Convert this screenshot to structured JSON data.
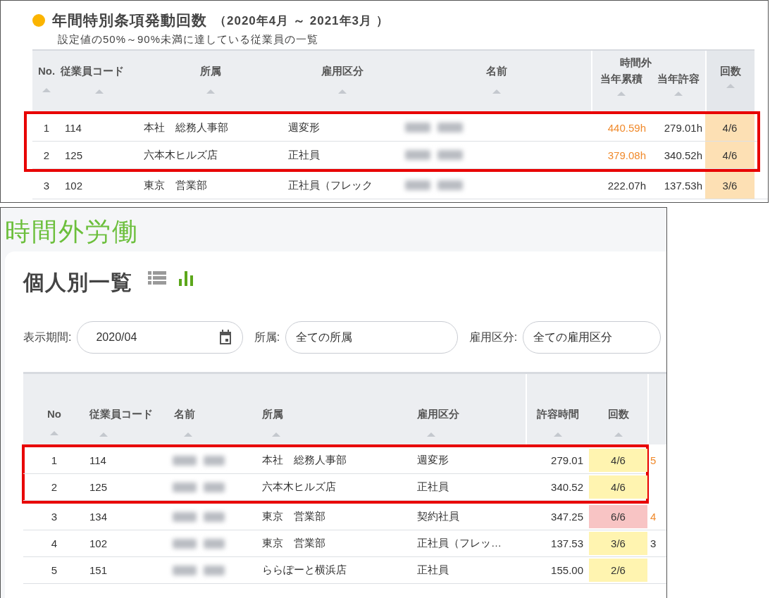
{
  "top_panel": {
    "title": "年間特別条項発動回数",
    "period": "（2020年4月 ～ 2021年3月 ）",
    "subtitle": "設定値の50%～90%未満に達している従業員の一覧",
    "columns": [
      "No.",
      "従業員コード",
      "所属",
      "雇用区分",
      "名前"
    ],
    "group_header": "時間外",
    "group_columns": [
      "当年累積",
      "当年許容"
    ],
    "count_column": "回数",
    "rows": [
      {
        "no": "1",
        "code": "114",
        "dept": "本社　総務人事部",
        "type": "週変形",
        "over": true,
        "total": "440.59h",
        "allowed": "279.01h",
        "count": "4/6",
        "highlighted": true
      },
      {
        "no": "2",
        "code": "125",
        "dept": "六本木ヒルズ店",
        "type": "正社員",
        "over": true,
        "total": "379.08h",
        "allowed": "340.52h",
        "count": "4/6",
        "highlighted": true
      },
      {
        "no": "3",
        "code": "102",
        "dept": "東京　営業部",
        "type": "正社員（フレック",
        "over": false,
        "total": "222.07h",
        "allowed": "137.53h",
        "count": "3/6",
        "highlighted": false
      }
    ]
  },
  "bottom_panel": {
    "page_title": "時間外労働",
    "card_title": "個人別一覧",
    "view_buttons": [
      {
        "kind": "list",
        "selected": false
      },
      {
        "kind": "chart",
        "selected": true
      }
    ],
    "filters": [
      {
        "label": "表示期間:",
        "value": "2020/04",
        "kind": "date"
      },
      {
        "label": "所属:",
        "value": "全ての所属",
        "kind": "select"
      },
      {
        "label": "雇用区分:",
        "value": "全ての雇用区分",
        "kind": "select"
      }
    ],
    "columns": [
      "No",
      "従業員コード",
      "名前",
      "所属",
      "雇用区分",
      "許容時間",
      "回数"
    ],
    "rows": [
      {
        "no": "1",
        "code": "114",
        "dept": "本社　総務人事部",
        "type": "週変形",
        "allowed": "279.01",
        "count": {
          "text": "4/6",
          "color": "#fff4b0"
        },
        "column_8": "5",
        "column_8_over": true,
        "highlighted": true
      },
      {
        "no": "2",
        "code": "125",
        "dept": "六本木ヒルズ店",
        "type": "正社員",
        "allowed": "340.52",
        "count": {
          "text": "4/6",
          "color": "#fff4b0"
        },
        "highlighted": true
      },
      {
        "no": "3",
        "code": "134",
        "dept": "東京　営業部",
        "type": "契約社員",
        "allowed": "347.25",
        "count": {
          "text": "6/6",
          "color": "#f8c4c4"
        },
        "column_8": "4",
        "column_8_over": true,
        "highlighted": false
      },
      {
        "no": "4",
        "code": "102",
        "dept": "東京　営業部",
        "type": "正社員（フレッ…",
        "allowed": "137.53",
        "count": {
          "text": "3/6",
          "color": "#fff4b0"
        },
        "column_8": "3",
        "column_8_over": false,
        "highlighted": false
      },
      {
        "no": "5",
        "code": "151",
        "dept": "ららぽーと横浜店",
        "type": "正社員",
        "allowed": "155.00",
        "count": {
          "text": "2/6",
          "color": "#fff4b0"
        },
        "highlighted": false
      }
    ]
  }
}
